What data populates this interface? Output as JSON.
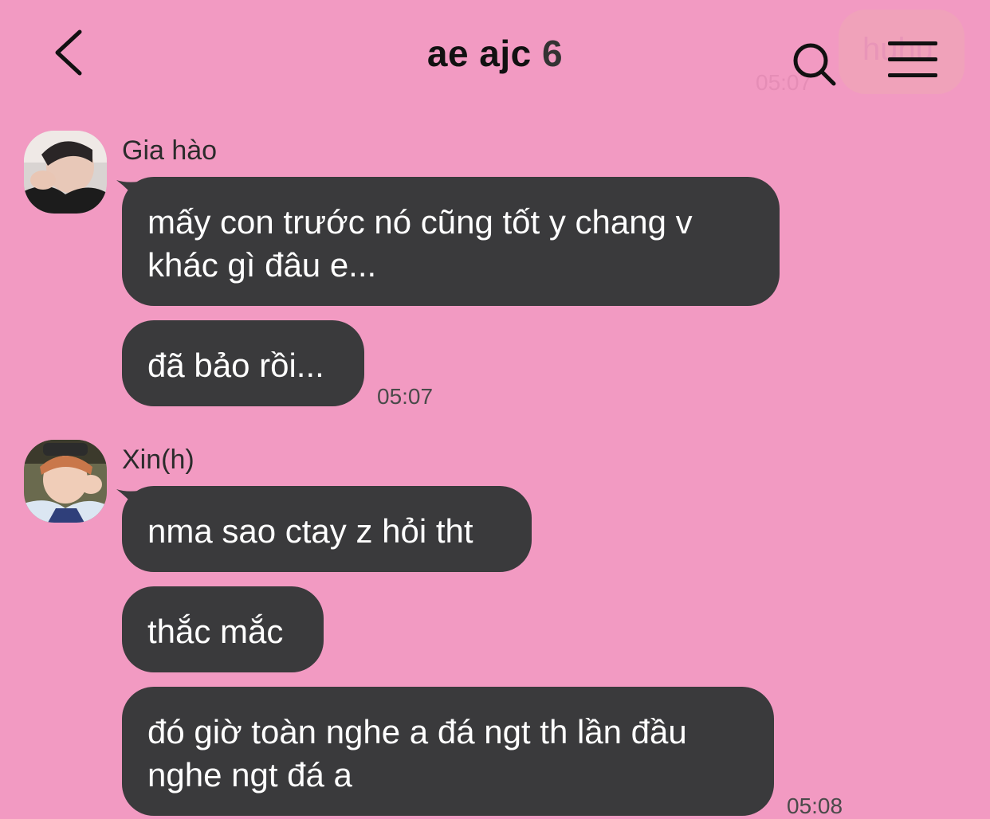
{
  "header": {
    "title": "ae ajc",
    "member_count": "6",
    "ghost_text": "huhu",
    "ghost_time": "05:07",
    "icons": {
      "back": "chevron-left-icon",
      "search": "search-icon",
      "menu": "hamburger-menu-icon"
    }
  },
  "messages": [
    {
      "sender": "Gia hào",
      "bubbles": [
        "mấy con trước nó cũng tốt y chang v khác gì đâu e...",
        "đã bảo rồi..."
      ],
      "time": "05:07"
    },
    {
      "sender": "Xin(h)",
      "bubbles": [
        "nma sao ctay z hỏi tht",
        "thắc mắc",
        "đó giờ toàn nghe a đá ngt th lần đầu nghe ngt đá a"
      ],
      "time": "05:08"
    }
  ],
  "colors": {
    "background": "#F29AC2",
    "bubble": "#3A3A3C",
    "bubble_text": "#FFFFFF"
  }
}
